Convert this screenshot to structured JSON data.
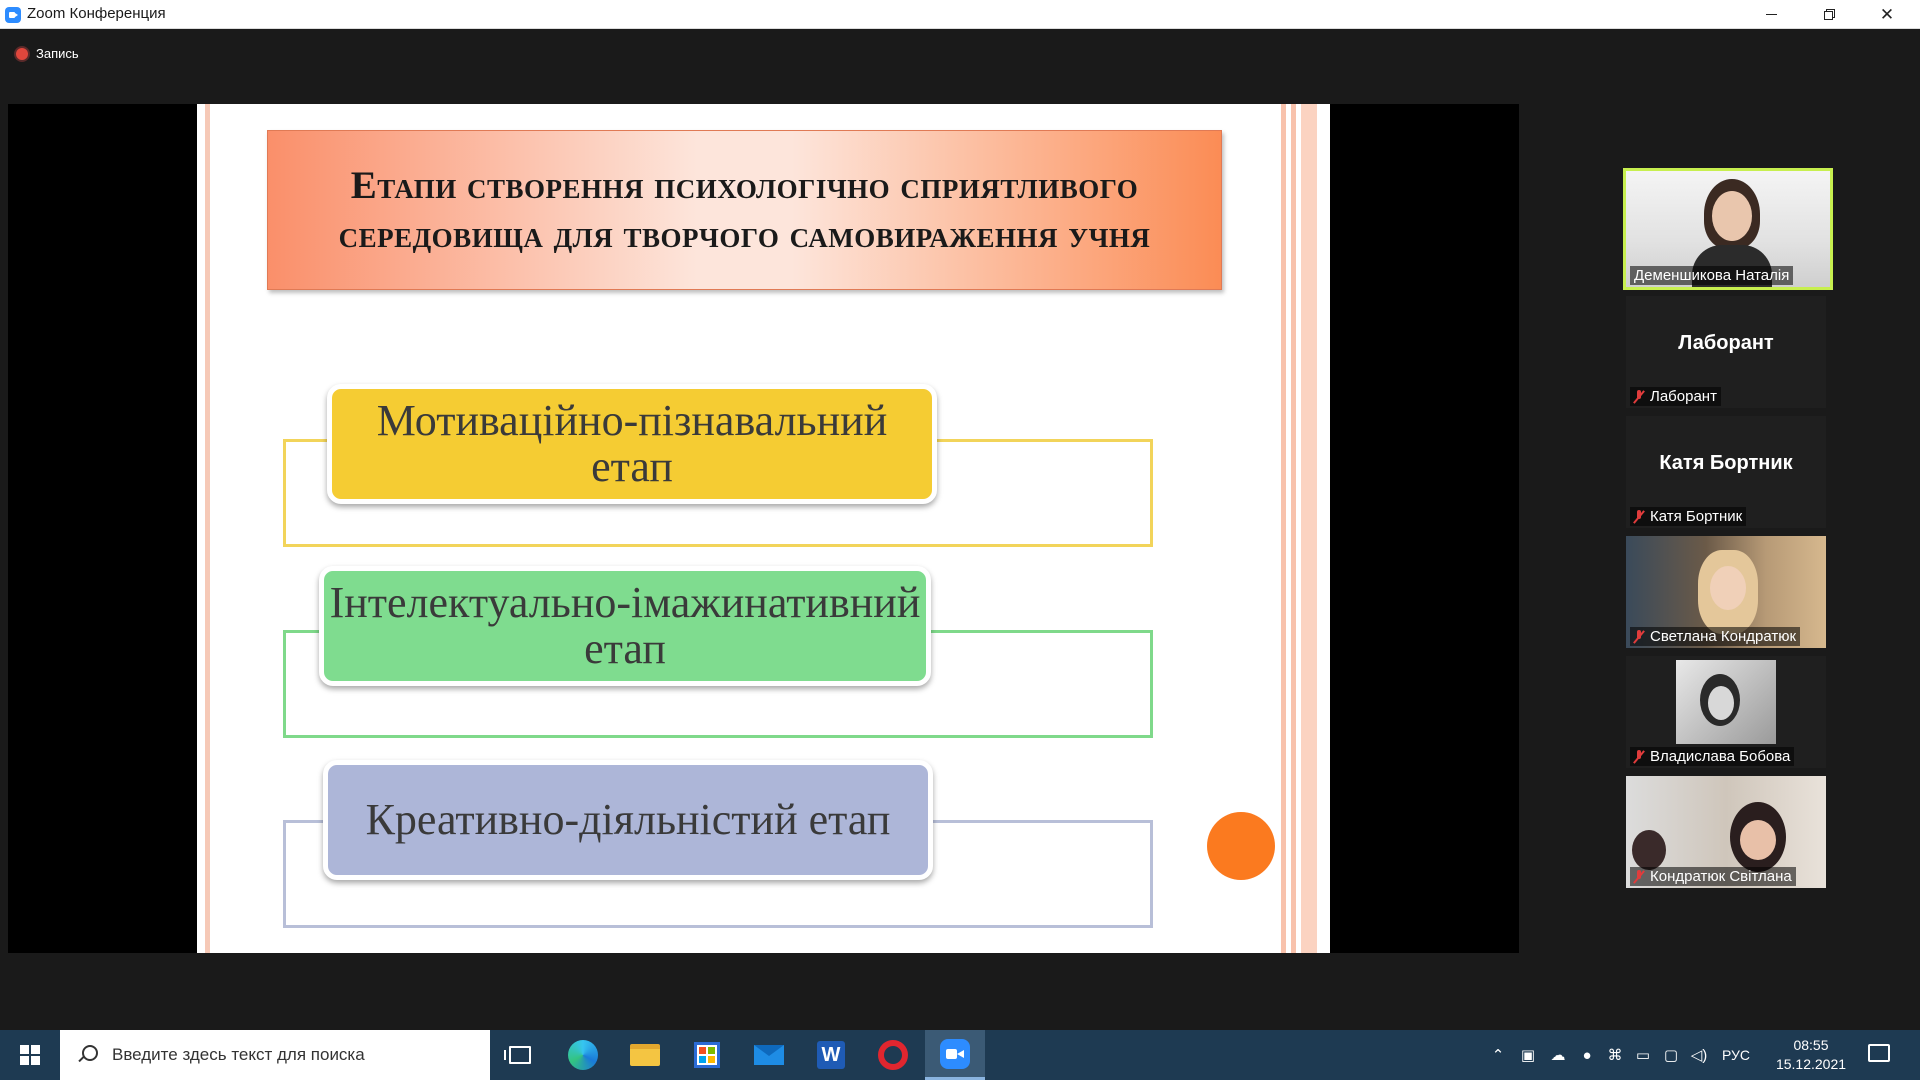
{
  "window": {
    "title": "Zoom Конференция"
  },
  "recording": {
    "label": "Запись",
    "color": "#e0463c"
  },
  "slide": {
    "title": "Етапи створення психологічно сприятливого середовища для творчого самовираження учня",
    "stages": [
      {
        "label": "Мотиваційно-пізнавальний етап",
        "fill": "#f5cc33",
        "frame": "#f2d45a"
      },
      {
        "label": "Інтелектуально-імажинативний етап",
        "fill": "#7fdc8f",
        "frame": "#7fd98a"
      },
      {
        "label": "Креативно-діяльністий етап",
        "fill": "#adb6d8",
        "frame": "#b8bfd8"
      }
    ],
    "accent": "#fb7a1f"
  },
  "participants": [
    {
      "name": "Деменшикова Наталія",
      "video": true,
      "active": true,
      "muted": false
    },
    {
      "name": "Лаборант",
      "video": false,
      "active": false,
      "muted": true,
      "display": "Лаборант"
    },
    {
      "name": "Катя Бортник",
      "video": false,
      "active": false,
      "muted": true,
      "display": "Катя Бортник"
    },
    {
      "name": "Светлана Кондратюк",
      "video": true,
      "active": false,
      "muted": true
    },
    {
      "name": "Владислава Бобова",
      "video": true,
      "active": false,
      "muted": true
    },
    {
      "name": "Кондратюк Світлана",
      "video": true,
      "active": false,
      "muted": true
    }
  ],
  "taskbar": {
    "search_placeholder": "Введите здесь текст для поиска",
    "apps": [
      "task-view",
      "edge",
      "file-explorer",
      "microsoft-store",
      "mail",
      "word",
      "opera",
      "zoom"
    ],
    "active_app": "zoom",
    "language": "РУС",
    "time": "08:55",
    "date": "15.12.2021"
  }
}
